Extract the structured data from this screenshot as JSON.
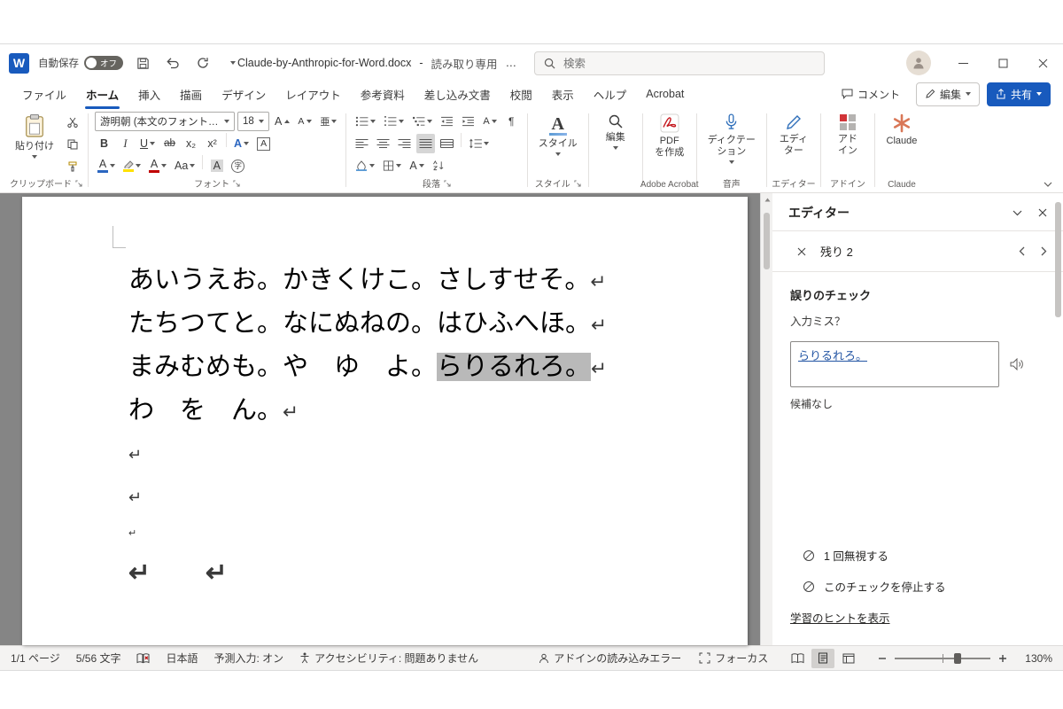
{
  "titlebar": {
    "autosave_label": "自動保存",
    "autosave_state": "オフ",
    "doc_title": "Claude-by-Anthropic-for-Word.docx",
    "separator": "-",
    "doc_mode": "読み取り専用",
    "more_dots": "…",
    "search_placeholder": "検索"
  },
  "tabs": {
    "items": [
      {
        "label": "ファイル"
      },
      {
        "label": "ホーム"
      },
      {
        "label": "挿入"
      },
      {
        "label": "描画"
      },
      {
        "label": "デザイン"
      },
      {
        "label": "レイアウト"
      },
      {
        "label": "参考資料"
      },
      {
        "label": "差し込み文書"
      },
      {
        "label": "校閲"
      },
      {
        "label": "表示"
      },
      {
        "label": "ヘルプ"
      },
      {
        "label": "Acrobat"
      }
    ],
    "comments_label": "コメント",
    "editing_label": "編集",
    "share_label": "共有"
  },
  "ribbon": {
    "paste_label": "貼り付け",
    "font_name": "游明朝 (本文のフォント - 日本語",
    "font_size": "18",
    "bold": "B",
    "italic": "I",
    "underline": "U",
    "strike": "ab",
    "subscript": "x₂",
    "superscript": "x²",
    "effects": "A",
    "font_color": "A",
    "text_highlight": "A",
    "change_case": "Aa",
    "grow_font": "A",
    "shrink_font": "A",
    "ruby": "亜",
    "enclose_a": "A",
    "shading_a": "A",
    "asian_a": "A",
    "enclose_char": "字",
    "pilcrow": "¶",
    "styles_label": "スタイル",
    "editing_label": "編集",
    "pdf_label_1": "PDF",
    "pdf_label_2": "を作成",
    "dictation_label_1": "ディクテー",
    "dictation_label_2": "ション",
    "editor_label_1": "エディ",
    "editor_label_2": "ター",
    "addins_label_1": "アド",
    "addins_label_2": "イン",
    "claude_label": "Claude",
    "groups": {
      "clipboard": "クリップボード",
      "font": "フォント",
      "paragraph": "段落",
      "styles": "スタイル",
      "acrobat": "Adobe Acrobat",
      "voice": "音声",
      "editor": "エディター",
      "addins": "アドイン",
      "claude": "Claude"
    }
  },
  "document": {
    "lines": [
      {
        "pre": "あいうえお。かきくけこ。さしすせそ。",
        "hl": "",
        "mark": "↵"
      },
      {
        "pre": "たちつてと。なにぬねの。はひふへほ。",
        "hl": "",
        "mark": "↵"
      },
      {
        "pre": "まみむめも。や　ゆ　よ。",
        "hl": "らりるれろ。",
        "mark": "↵"
      },
      {
        "pre": "わ　を　ん。",
        "hl": "",
        "mark": "↵"
      },
      {
        "pre": "",
        "hl": "",
        "mark": "↵"
      },
      {
        "pre": "",
        "hl": "",
        "mark": "↵"
      },
      {
        "pre": "",
        "hl": "",
        "mark": "↵"
      },
      {
        "pre": "",
        "hl": "",
        "mark": "↵",
        "mark2": "↵"
      }
    ]
  },
  "editor_pane": {
    "title": "エディター",
    "remaining_label": "残り 2",
    "check_title": "誤りのチェック",
    "check_subtitle": "入力ミス？",
    "flagged_text": "らりるれろ。",
    "no_candidates": "候補なし",
    "ignore_once": "1 回無視する",
    "stop_check": "このチェックを停止する",
    "learning_link": "学習のヒントを表示"
  },
  "statusbar": {
    "page_count": "1/1 ページ",
    "char_count": "5/56 文字",
    "language": "日本語",
    "ime_mode": "予測入力: オン",
    "accessibility": "アクセシビリティ: 問題ありません",
    "addin_error": "アドインの読み込みエラー",
    "focus_label": "フォーカス",
    "zoom_level": "130%"
  },
  "colors": {
    "accent_blue": "#185abd",
    "claude_orange": "#d97757",
    "selection_gray": "#b9b9b9",
    "flagged_text_blue": "#2456a4",
    "doc_background": "#858585"
  }
}
